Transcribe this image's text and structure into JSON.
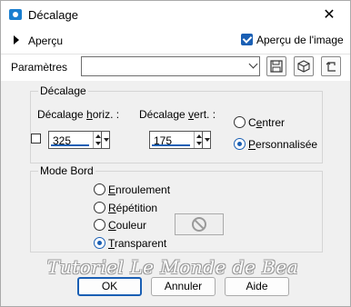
{
  "window": {
    "title": "Décalage",
    "close_label": "✕"
  },
  "toolbar": {
    "apercu_label": "Aperçu",
    "apercu_image_label": "Aperçu de l'image"
  },
  "params": {
    "label": "Paramètres",
    "combo_value": ""
  },
  "offset_group": {
    "title": "Décalage",
    "horiz_label_pre": "Décalage ",
    "horiz_label_key": "h",
    "horiz_label_post": "oriz. :",
    "vert_label_pre": "Décalage ",
    "vert_label_key": "v",
    "vert_label_post": "ert. :",
    "horiz_value": "325",
    "vert_value": "175",
    "centrer_pre": "C",
    "centrer_key": "e",
    "centrer_post": "ntrer",
    "perso_pre": "",
    "perso_key": "P",
    "perso_post": "ersonnalisée"
  },
  "mode_group": {
    "title": "Mode Bord",
    "enroulement_key": "E",
    "enroulement_post": "nroulement",
    "repetition_key": "R",
    "repetition_post": "épétition",
    "couleur_key": "C",
    "couleur_post": "ouleur",
    "transparent_key": "T",
    "transparent_post": "ransparent"
  },
  "watermark": "Tutoriel Le Monde de Bea",
  "buttons": {
    "ok": "OK",
    "annuler": "Annuler",
    "aide": "Aide"
  }
}
